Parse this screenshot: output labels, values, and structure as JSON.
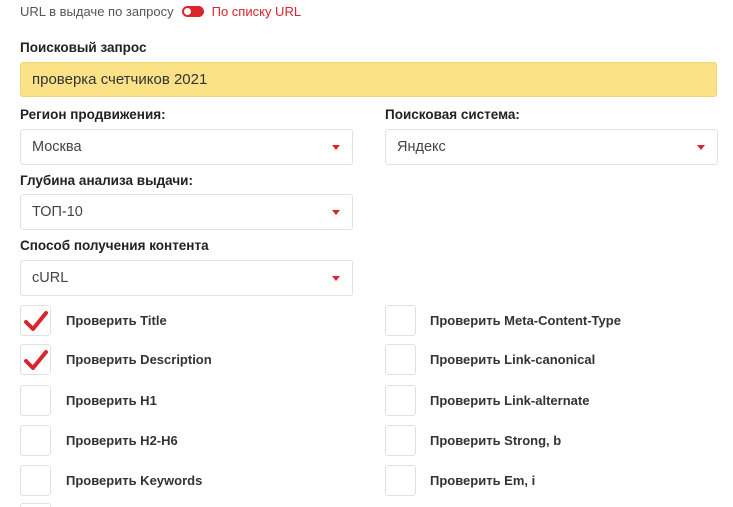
{
  "url_mode": {
    "left_label": "URL в выдаче по запросу",
    "right_label": "По списку URL",
    "accent": "#d9252b"
  },
  "query": {
    "heading": "Поисковый запрос",
    "value": "проверка счетчиков 2021",
    "bg": "#fbe286"
  },
  "region": {
    "heading": "Регион продвижения:",
    "value": "Москва"
  },
  "engine": {
    "heading": "Поисковая система:",
    "value": "Яндекс"
  },
  "depth": {
    "heading": "Глубина анализа выдачи:",
    "value": "ТОП-10"
  },
  "method": {
    "heading": "Способ получения контента",
    "value": "cURL"
  },
  "checks_left": [
    {
      "label": "Проверить Title",
      "checked": true
    },
    {
      "label": "Проверить Description",
      "checked": true
    },
    {
      "label": "Проверить H1",
      "checked": false
    },
    {
      "label": "Проверить H2-H6",
      "checked": false
    },
    {
      "label": "Проверить Keywords",
      "checked": false
    }
  ],
  "checks_right": [
    {
      "label": "Проверить Meta-Content-Type",
      "checked": false
    },
    {
      "label": "Проверить Link-canonical",
      "checked": false
    },
    {
      "label": "Проверить Link-alternate",
      "checked": false
    },
    {
      "label": "Проверить Strong, b",
      "checked": false
    },
    {
      "label": "Проверить Em, i",
      "checked": false
    }
  ]
}
